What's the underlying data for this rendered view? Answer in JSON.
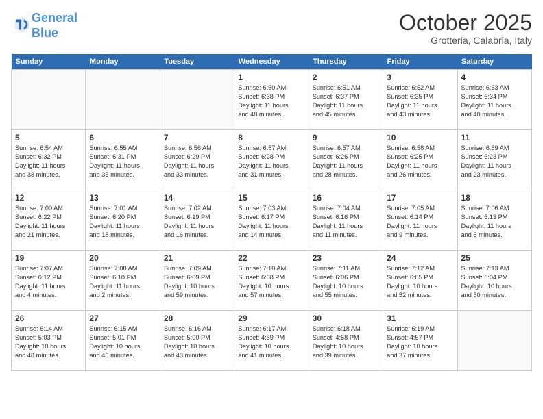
{
  "header": {
    "logo_line1": "General",
    "logo_line2": "Blue",
    "month": "October 2025",
    "location": "Grotteria, Calabria, Italy"
  },
  "weekdays": [
    "Sunday",
    "Monday",
    "Tuesday",
    "Wednesday",
    "Thursday",
    "Friday",
    "Saturday"
  ],
  "weeks": [
    [
      {
        "day": "",
        "info": ""
      },
      {
        "day": "",
        "info": ""
      },
      {
        "day": "",
        "info": ""
      },
      {
        "day": "1",
        "info": "Sunrise: 6:50 AM\nSunset: 6:38 PM\nDaylight: 11 hours\nand 48 minutes."
      },
      {
        "day": "2",
        "info": "Sunrise: 6:51 AM\nSunset: 6:37 PM\nDaylight: 11 hours\nand 45 minutes."
      },
      {
        "day": "3",
        "info": "Sunrise: 6:52 AM\nSunset: 6:35 PM\nDaylight: 11 hours\nand 43 minutes."
      },
      {
        "day": "4",
        "info": "Sunrise: 6:53 AM\nSunset: 6:34 PM\nDaylight: 11 hours\nand 40 minutes."
      }
    ],
    [
      {
        "day": "5",
        "info": "Sunrise: 6:54 AM\nSunset: 6:32 PM\nDaylight: 11 hours\nand 38 minutes."
      },
      {
        "day": "6",
        "info": "Sunrise: 6:55 AM\nSunset: 6:31 PM\nDaylight: 11 hours\nand 35 minutes."
      },
      {
        "day": "7",
        "info": "Sunrise: 6:56 AM\nSunset: 6:29 PM\nDaylight: 11 hours\nand 33 minutes."
      },
      {
        "day": "8",
        "info": "Sunrise: 6:57 AM\nSunset: 6:28 PM\nDaylight: 11 hours\nand 31 minutes."
      },
      {
        "day": "9",
        "info": "Sunrise: 6:57 AM\nSunset: 6:26 PM\nDaylight: 11 hours\nand 28 minutes."
      },
      {
        "day": "10",
        "info": "Sunrise: 6:58 AM\nSunset: 6:25 PM\nDaylight: 11 hours\nand 26 minutes."
      },
      {
        "day": "11",
        "info": "Sunrise: 6:59 AM\nSunset: 6:23 PM\nDaylight: 11 hours\nand 23 minutes."
      }
    ],
    [
      {
        "day": "12",
        "info": "Sunrise: 7:00 AM\nSunset: 6:22 PM\nDaylight: 11 hours\nand 21 minutes."
      },
      {
        "day": "13",
        "info": "Sunrise: 7:01 AM\nSunset: 6:20 PM\nDaylight: 11 hours\nand 18 minutes."
      },
      {
        "day": "14",
        "info": "Sunrise: 7:02 AM\nSunset: 6:19 PM\nDaylight: 11 hours\nand 16 minutes."
      },
      {
        "day": "15",
        "info": "Sunrise: 7:03 AM\nSunset: 6:17 PM\nDaylight: 11 hours\nand 14 minutes."
      },
      {
        "day": "16",
        "info": "Sunrise: 7:04 AM\nSunset: 6:16 PM\nDaylight: 11 hours\nand 11 minutes."
      },
      {
        "day": "17",
        "info": "Sunrise: 7:05 AM\nSunset: 6:14 PM\nDaylight: 11 hours\nand 9 minutes."
      },
      {
        "day": "18",
        "info": "Sunrise: 7:06 AM\nSunset: 6:13 PM\nDaylight: 11 hours\nand 6 minutes."
      }
    ],
    [
      {
        "day": "19",
        "info": "Sunrise: 7:07 AM\nSunset: 6:12 PM\nDaylight: 11 hours\nand 4 minutes."
      },
      {
        "day": "20",
        "info": "Sunrise: 7:08 AM\nSunset: 6:10 PM\nDaylight: 11 hours\nand 2 minutes."
      },
      {
        "day": "21",
        "info": "Sunrise: 7:09 AM\nSunset: 6:09 PM\nDaylight: 10 hours\nand 59 minutes."
      },
      {
        "day": "22",
        "info": "Sunrise: 7:10 AM\nSunset: 6:08 PM\nDaylight: 10 hours\nand 57 minutes."
      },
      {
        "day": "23",
        "info": "Sunrise: 7:11 AM\nSunset: 6:06 PM\nDaylight: 10 hours\nand 55 minutes."
      },
      {
        "day": "24",
        "info": "Sunrise: 7:12 AM\nSunset: 6:05 PM\nDaylight: 10 hours\nand 52 minutes."
      },
      {
        "day": "25",
        "info": "Sunrise: 7:13 AM\nSunset: 6:04 PM\nDaylight: 10 hours\nand 50 minutes."
      }
    ],
    [
      {
        "day": "26",
        "info": "Sunrise: 6:14 AM\nSunset: 5:03 PM\nDaylight: 10 hours\nand 48 minutes."
      },
      {
        "day": "27",
        "info": "Sunrise: 6:15 AM\nSunset: 5:01 PM\nDaylight: 10 hours\nand 46 minutes."
      },
      {
        "day": "28",
        "info": "Sunrise: 6:16 AM\nSunset: 5:00 PM\nDaylight: 10 hours\nand 43 minutes."
      },
      {
        "day": "29",
        "info": "Sunrise: 6:17 AM\nSunset: 4:59 PM\nDaylight: 10 hours\nand 41 minutes."
      },
      {
        "day": "30",
        "info": "Sunrise: 6:18 AM\nSunset: 4:58 PM\nDaylight: 10 hours\nand 39 minutes."
      },
      {
        "day": "31",
        "info": "Sunrise: 6:19 AM\nSunset: 4:57 PM\nDaylight: 10 hours\nand 37 minutes."
      },
      {
        "day": "",
        "info": ""
      }
    ]
  ]
}
